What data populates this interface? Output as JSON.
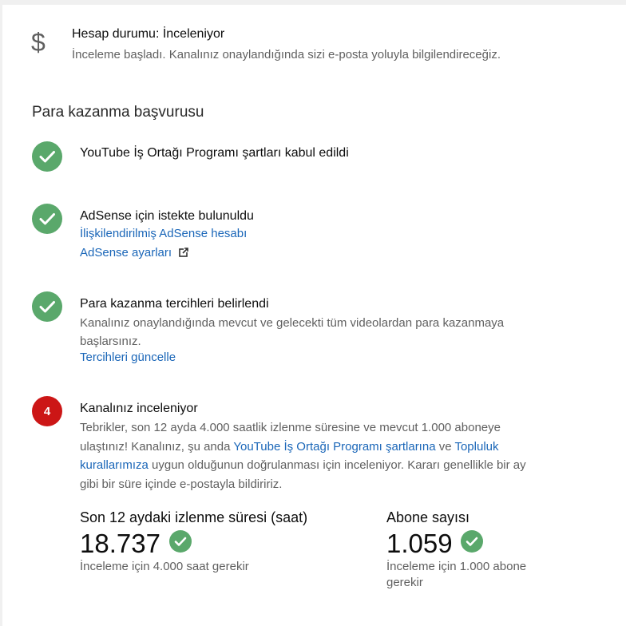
{
  "account_status": {
    "icon": "dollar-icon",
    "title": "Hesap durumu: İnceleniyor",
    "subtitle": "İnceleme başladı. Kanalınız onaylandığında sizi e-posta yoluyla bilgilendireceğiz."
  },
  "section_title": "Para kazanma başvurusu",
  "steps": [
    {
      "status": "done",
      "title": "YouTube İş Ortağı Programı şartları kabul edildi"
    },
    {
      "status": "done",
      "title": "AdSense için istekte bulunuldu",
      "link1": "İlişkilendirilmiş AdSense hesabı",
      "link2": "AdSense ayarları"
    },
    {
      "status": "done",
      "title": "Para kazanma tercihleri belirlendi",
      "text": "Kanalınız onaylandığında mevcut ve gelecekti tüm videolardan para kazanmaya başlarsınız.",
      "link1": "Tercihleri güncelle"
    },
    {
      "status": "in-review",
      "number": "4",
      "title": "Kanalınız inceleniyor",
      "text_part1": "Tebrikler, son 12 ayda 4.000 saatlik izlenme süresine ve mevcut 1.000 aboneye ulaştınız! Kanalınız, şu anda ",
      "link_ypp": "YouTube İş Ortağı Programı şartlarına",
      "text_part2": " ve ",
      "link_guidelines": "Topluluk kurallarımıza",
      "text_part3": " uygun olduğunun doğrulanması için inceleniyor. Kararı genellikle bir ay gibi bir süre içinde e-postayla bildiririz."
    }
  ],
  "metrics": {
    "watch_time": {
      "label": "Son 12 aydaki izlenme süresi (saat)",
      "value": "18.737",
      "note": "İnceleme için 4.000 saat gerekir"
    },
    "subscribers": {
      "label": "Abone sayısı",
      "value": "1.059",
      "note_line1": "İnceleme için 1.000 abone",
      "note_line2": "gerekir"
    }
  },
  "colors": {
    "check_green": "#5aa86b",
    "review_red": "#cc1616",
    "link_blue": "#1a66b8"
  }
}
